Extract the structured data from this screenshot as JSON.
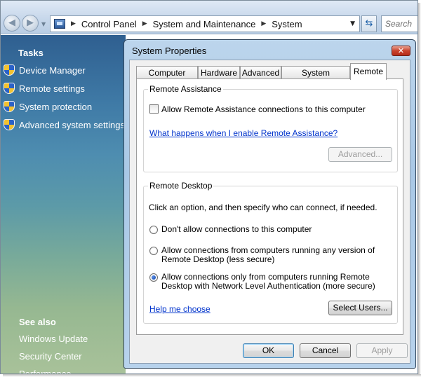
{
  "address_bar": {
    "crumbs": [
      "Control Panel",
      "System and Maintenance",
      "System"
    ],
    "search_placeholder": "Search"
  },
  "left_pane": {
    "tasks_heading": "Tasks",
    "tasks": [
      "Device Manager",
      "Remote settings",
      "System protection",
      "Advanced system settings"
    ],
    "see_also_heading": "See also",
    "see_also": [
      "Windows Update",
      "Security Center",
      "Performance"
    ]
  },
  "dialog": {
    "title": "System Properties",
    "close_glyph": "✕",
    "tabs": [
      "Computer Name",
      "Hardware",
      "Advanced",
      "System Protection",
      "Remote"
    ],
    "active_tab": "Remote",
    "remote_assistance": {
      "title": "Remote Assistance",
      "checkbox_label": "Allow Remote Assistance connections to this computer",
      "checked": false,
      "help_link": "What happens when I enable Remote Assistance?",
      "advanced_button": "Advanced..."
    },
    "remote_desktop": {
      "title": "Remote Desktop",
      "instruction": "Click an option, and then specify who can connect, if needed.",
      "options": [
        {
          "line1": "Don't allow connections to this computer",
          "line2": ""
        },
        {
          "line1": "Allow connections from computers running any version of",
          "line2": "Remote Desktop (less secure)"
        },
        {
          "line1": "Allow connections only from computers running Remote",
          "line2": "Desktop with Network Level Authentication (more secure)"
        }
      ],
      "selected_option": 2,
      "help_link": "Help me choose",
      "select_users_button": "Select Users..."
    },
    "buttons": {
      "ok": "OK",
      "cancel": "Cancel",
      "apply": "Apply"
    }
  },
  "colors": {
    "link": "#0033cc",
    "dialog_frame": "#b7d2ec"
  }
}
